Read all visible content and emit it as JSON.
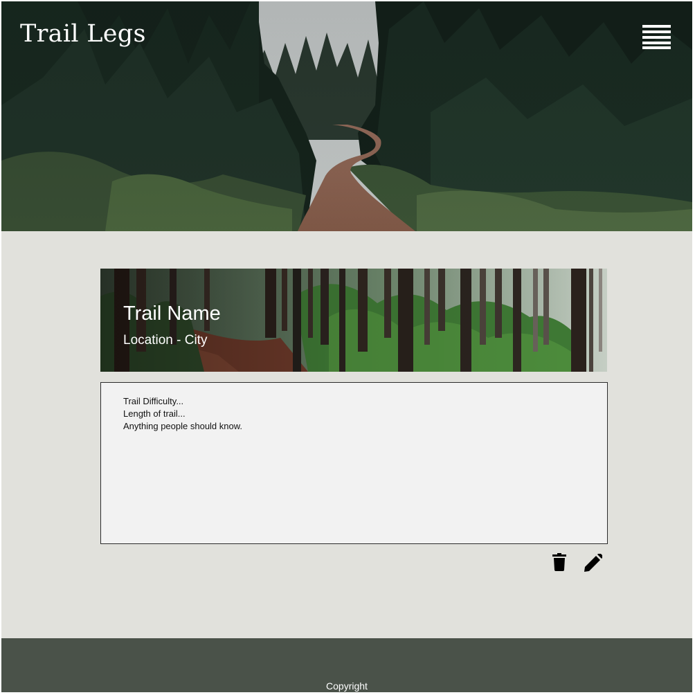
{
  "header": {
    "site_title": "Trail Legs",
    "menu_icon": "hamburger-menu-icon"
  },
  "trail": {
    "name": "Trail Name",
    "location": "Location - City",
    "details": [
      "Trail Difficulty...",
      "Length of trail...",
      "Anything people should know."
    ]
  },
  "actions": {
    "delete_icon": "trash-icon",
    "edit_icon": "pencil-icon"
  },
  "footer": {
    "copyright": "Copyright"
  },
  "colors": {
    "page_background": "#e1e1dc",
    "footer_background": "#4a5249",
    "details_background": "#f2f2f2",
    "header_text": "#ffffff"
  }
}
